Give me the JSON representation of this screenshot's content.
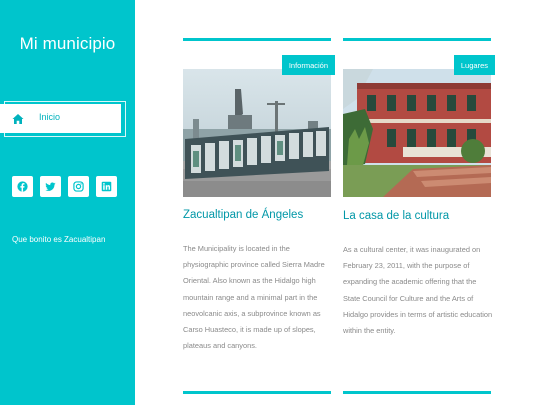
{
  "site": {
    "title": "Mi municipio",
    "tagline": "Que bonito es Zacualtipan"
  },
  "nav": {
    "items": [
      {
        "label": "Inicio",
        "icon": "home-icon"
      }
    ]
  },
  "socials": [
    {
      "name": "facebook-icon"
    },
    {
      "name": "twitter-icon"
    },
    {
      "name": "instagram-icon"
    },
    {
      "name": "linkedin-icon"
    }
  ],
  "posts": [
    {
      "category": "Información",
      "title": "Zacualtipan de Ángeles",
      "excerpt": "The Municipality is located in the physiographic province called Sierra Madre Oriental. Also known as the Hidalgo high mountain range and a minimal part in the neovolcanic axis, a subprovince known as Carso Huasteco, it is made up of slopes, plateaus and canyons."
    },
    {
      "category": "Lugares",
      "title": "La casa de la cultura",
      "excerpt": "As a cultural center, it was inaugurated on February 23, 2011, with the purpose of expanding the academic offering that the State Council for Culture and the Arts of Hidalgo provides in terms of artistic education within the entity."
    }
  ],
  "colors": {
    "accent": "#00c5cc",
    "title": "#0097a7",
    "text": "#8a8a8a"
  }
}
